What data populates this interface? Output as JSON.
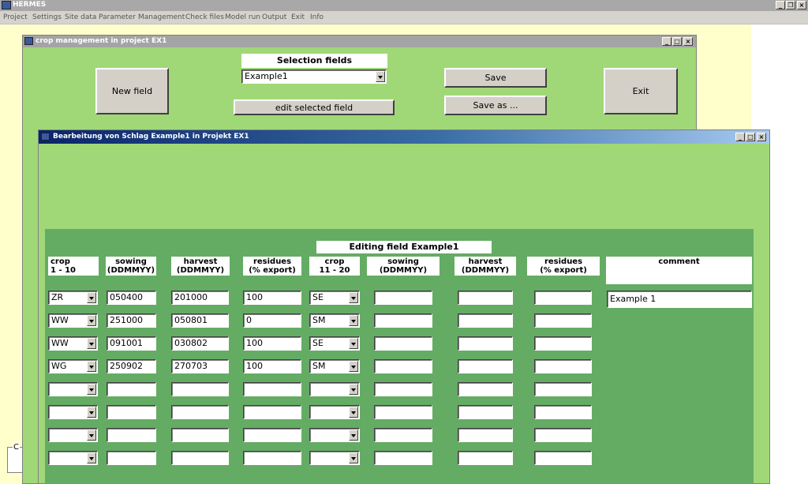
{
  "app": {
    "title": "HERMES"
  },
  "menu": [
    "Project",
    "Settings",
    "Site data",
    "Parameter",
    "Management",
    "Check files",
    "Model run",
    "Output",
    "Exit",
    "Info"
  ],
  "win1": {
    "title": "crop management in project EX1",
    "new_field": "New field",
    "selection_label": "Selection fields",
    "selection_value": "Example1",
    "edit_selected": "edit selected field",
    "save": "Save",
    "save_as": "Save as ...",
    "exit": "Exit"
  },
  "win2": {
    "title": "Bearbeitung von Schlag Example1  in Projekt EX1",
    "editing_label": "Editing field Example1",
    "headers": {
      "crop1": [
        "crop",
        "1 - 10"
      ],
      "sowing1": [
        "sowing",
        "(DDMMYY)"
      ],
      "harvest1": [
        "harvest",
        "(DDMMYY)"
      ],
      "residues1": [
        "residues",
        "(% export)"
      ],
      "crop2": [
        "crop",
        "11 - 20"
      ],
      "sowing2": [
        "sowing",
        "(DDMMYY)"
      ],
      "harvest2": [
        "harvest",
        "(DDMMYY)"
      ],
      "residues2": [
        "residues",
        "(% export)"
      ],
      "comment": "comment"
    },
    "comment_value": "Example 1",
    "rows": [
      {
        "crop1": "ZR",
        "sowing1": "050400",
        "harvest1": "201000",
        "residues1": "100",
        "crop2": "SE",
        "sowing2": "",
        "harvest2": "",
        "residues2": ""
      },
      {
        "crop1": "WW",
        "sowing1": "251000",
        "harvest1": "050801",
        "residues1": "0",
        "crop2": "SM",
        "sowing2": "",
        "harvest2": "",
        "residues2": ""
      },
      {
        "crop1": "WW",
        "sowing1": "091001",
        "harvest1": "030802",
        "residues1": "100",
        "crop2": "SE",
        "sowing2": "",
        "harvest2": "",
        "residues2": ""
      },
      {
        "crop1": "WG",
        "sowing1": "250902",
        "harvest1": "270703",
        "residues1": "100",
        "crop2": "SM",
        "sowing2": "",
        "harvest2": "",
        "residues2": ""
      },
      {
        "crop1": "",
        "sowing1": "",
        "harvest1": "",
        "residues1": "",
        "crop2": "",
        "sowing2": "",
        "harvest2": "",
        "residues2": ""
      },
      {
        "crop1": "",
        "sowing1": "",
        "harvest1": "",
        "residues1": "",
        "crop2": "",
        "sowing2": "",
        "harvest2": "",
        "residues2": ""
      },
      {
        "crop1": "",
        "sowing1": "",
        "harvest1": "",
        "residues1": "",
        "crop2": "",
        "sowing2": "",
        "harvest2": "",
        "residues2": ""
      },
      {
        "crop1": "",
        "sowing1": "",
        "harvest1": "",
        "residues1": "",
        "crop2": "",
        "sowing2": "",
        "harvest2": "",
        "residues2": ""
      }
    ]
  },
  "background_fragment": "C"
}
